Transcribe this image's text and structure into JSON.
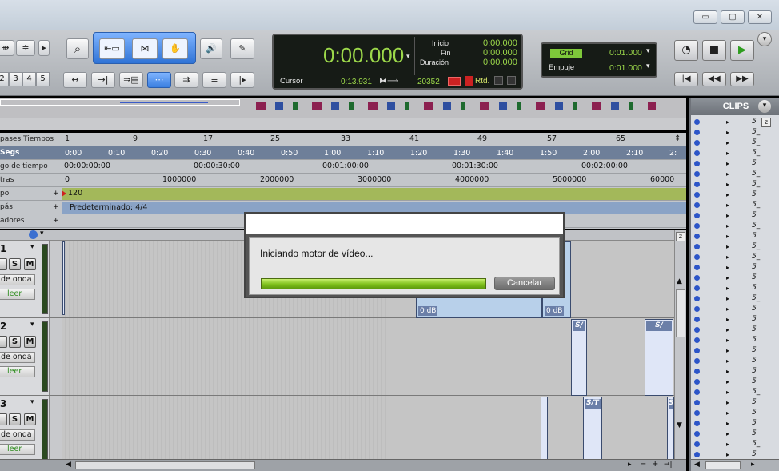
{
  "window": {
    "minimize_label": "▭",
    "restore_label": "▢",
    "close_label": "✕"
  },
  "toolbar": {
    "track_numbers": [
      "2",
      "3",
      "4",
      "5"
    ],
    "tool_icons": {
      "zoom": "magnifier-icon",
      "trim": "trim-icon",
      "select": "selector-icon",
      "grab": "hand-icon",
      "scrub": "speaker-icon",
      "pencil": "pencil-icon"
    }
  },
  "counter": {
    "main": "0:00.000",
    "inicio_label": "Inicio",
    "inicio_value": "0:00.000",
    "fin_label": "Fin",
    "fin_value": "0:00.000",
    "duracion_label": "Duración",
    "duracion_value": "0:00.000",
    "cursor_label": "Cursor",
    "cursor_value": "0:13.931",
    "samples_value": "20352",
    "rtd_label": "Rtd."
  },
  "grid": {
    "grid_label": "Grid",
    "grid_value": "0:01.000",
    "empuje_label": "Empuje",
    "empuje_value": "0:01.000"
  },
  "rulers": {
    "rows": [
      {
        "label": "pases|Tiempos",
        "ticks": [
          "1",
          "9",
          "17",
          "25",
          "33",
          "41",
          "49",
          "57",
          "65"
        ]
      },
      {
        "label": "Segs",
        "ticks": [
          "0:00",
          "0:10",
          "0:20",
          "0:30",
          "0:40",
          "0:50",
          "1:00",
          "1:10",
          "1:20",
          "1:30",
          "1:40",
          "1:50",
          "2:00",
          "2:10",
          "2:"
        ]
      },
      {
        "label": "go de tiempo",
        "ticks": [
          "00:00:00:00",
          "00:00:30:00",
          "00:01:00:00",
          "00:01:30:00",
          "00:02:00:00"
        ]
      },
      {
        "label": "tras",
        "ticks": [
          "0",
          "1000000",
          "2000000",
          "3000000",
          "4000000",
          "5000000",
          "60000"
        ]
      },
      {
        "label": "po",
        "ticks": [
          "120"
        ]
      },
      {
        "label": "pás",
        "ticks": [
          "Predeterminado: 4/4"
        ]
      },
      {
        "label": "adores",
        "ticks": []
      }
    ]
  },
  "tracks": [
    {
      "name": "1",
      "s": "S",
      "m": "M",
      "view": "de onda",
      "mode": "leer"
    },
    {
      "name": "2",
      "s": "S",
      "m": "M",
      "view": "de onda",
      "mode": "leer"
    },
    {
      "name": "3",
      "s": "S",
      "m": "M",
      "view": "de onda",
      "mode": "leer"
    }
  ],
  "clip_labels": {
    "gain1": "0 dB",
    "gain2": "0 dB",
    "c1": "S/",
    "c2": "S/",
    "c3": "S/T",
    "c4": "S"
  },
  "clips_panel": {
    "title": "CLIPS",
    "rows": [
      "5",
      "5_",
      "5_",
      "5_",
      "5",
      "5_",
      "5_",
      "5",
      "5_",
      "5",
      "5_",
      "5",
      "5_",
      "5_",
      "5",
      "5",
      "5",
      "5_",
      "5",
      "5",
      "5",
      "5",
      "5",
      "5",
      "5",
      "5",
      "5_",
      "5",
      "5",
      "5",
      "5",
      "5_",
      "5",
      "5",
      "5"
    ]
  },
  "dialog": {
    "message": "Iniciando motor de vídeo...",
    "cancel_label": "Cancelar",
    "progress": 1.0
  }
}
